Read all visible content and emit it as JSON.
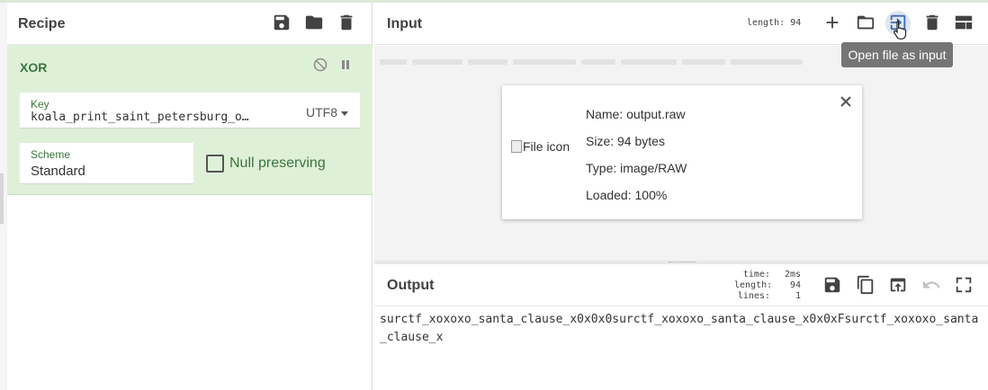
{
  "recipe": {
    "title": "Recipe",
    "icons": [
      "save-icon",
      "folder-icon",
      "trash-icon"
    ],
    "operation": {
      "name": "XOR",
      "key_label": "Key",
      "key_value": "koala_print_saint_petersburg_o…",
      "key_encoding": "UTF8",
      "scheme_label": "Scheme",
      "scheme_value": "Standard",
      "null_preserving_label": "Null preserving",
      "null_preserving_checked": false
    }
  },
  "input": {
    "title": "Input",
    "length_label": "length:",
    "length_value": "94",
    "tooltip": "Open file as input",
    "file": {
      "icon_alt": "File icon",
      "name": "Name: output.raw",
      "size": "Size: 94 bytes",
      "type": "Type: image/RAW",
      "loaded": "Loaded: 100%"
    }
  },
  "output": {
    "title": "Output",
    "stats": [
      {
        "key": "time:",
        "value": "2ms"
      },
      {
        "key": "length:",
        "value": "94"
      },
      {
        "key": "lines:",
        "value": "1"
      }
    ],
    "text": "surctf_xoxoxo_santa_clause_x0x0x0surctf_xoxoxo_santa_clause_x0x0xFsurctf_xoxoxo_santa_clause_x"
  },
  "colors": {
    "operation_bg": "#dff0d8",
    "operation_text": "#3c763d",
    "tooltip_bg": "#757575"
  }
}
